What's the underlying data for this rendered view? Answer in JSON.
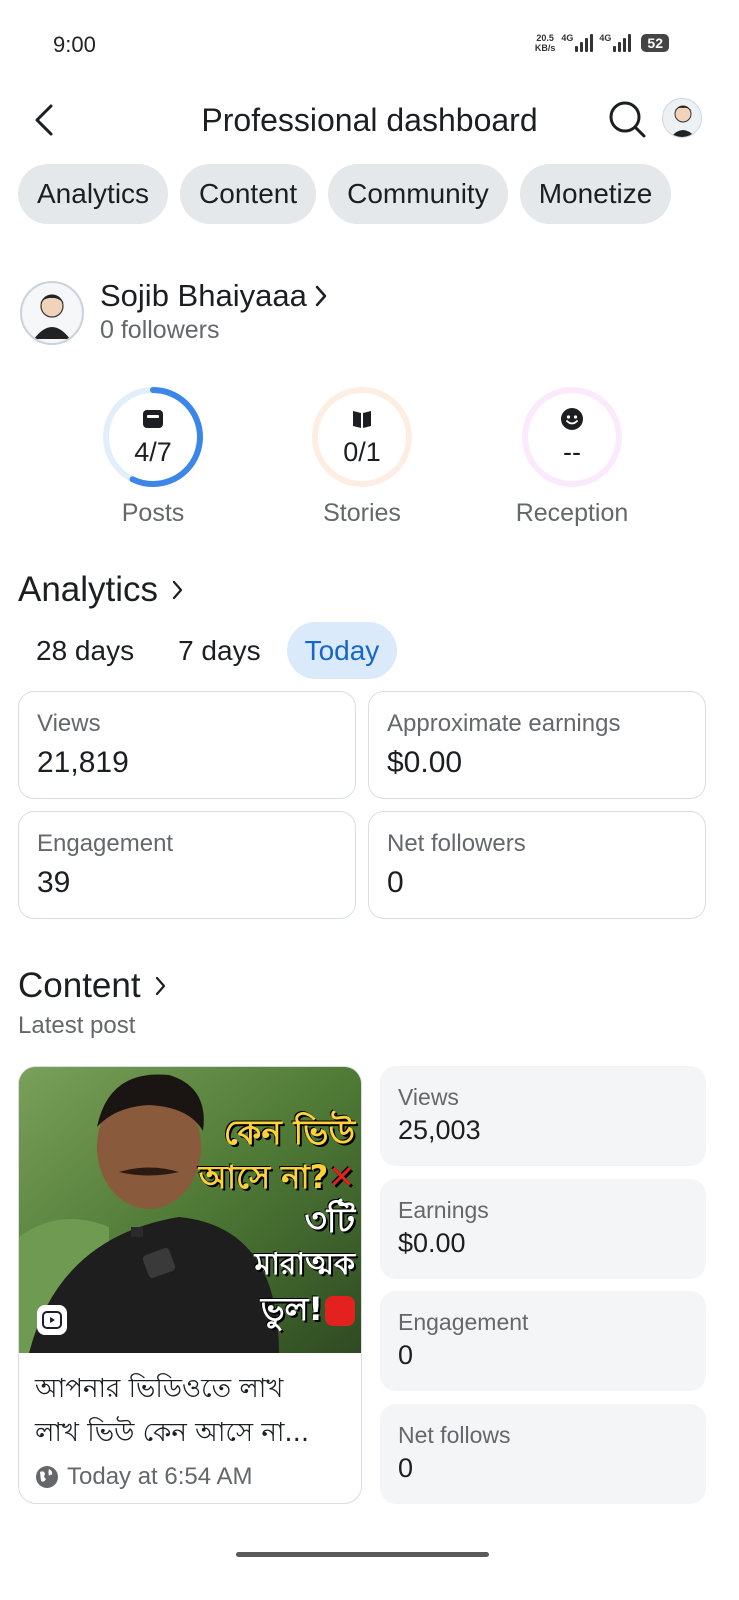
{
  "status_bar": {
    "time": "9:00",
    "net_speed_value": "20.5",
    "net_speed_unit": "KB/s",
    "network_1": "4G",
    "network_2": "4G",
    "battery": "52"
  },
  "header": {
    "title": "Professional dashboard"
  },
  "tabs": [
    {
      "label": "Analytics"
    },
    {
      "label": "Content"
    },
    {
      "label": "Community"
    },
    {
      "label": "Monetize"
    }
  ],
  "profile": {
    "name": "Sojib Bhaiyaaa",
    "followers": "0 followers",
    "avatar_text": "Sojib Bhaiyaaa"
  },
  "goals": [
    {
      "label": "Posts",
      "value": "4/7",
      "icon": "posts-icon",
      "progress": 0.571,
      "color": "#3b86e8",
      "track_color": "#e3eefb"
    },
    {
      "label": "Stories",
      "value": "0/1",
      "icon": "stories-icon",
      "progress": 0,
      "color": "#f1a36b",
      "track_color": "#fdeee4"
    },
    {
      "label": "Reception",
      "value": "--",
      "icon": "reception-icon",
      "progress": 0,
      "color": "#e08ae8",
      "track_color": "#fbe9fc"
    }
  ],
  "analytics": {
    "title": "Analytics",
    "periods": [
      {
        "label": "28 days",
        "active": false
      },
      {
        "label": "7 days",
        "active": false
      },
      {
        "label": "Today",
        "active": true
      }
    ],
    "metrics": [
      {
        "label": "Views",
        "value": "21,819"
      },
      {
        "label": "Approximate earnings",
        "value": "$0.00"
      },
      {
        "label": "Engagement",
        "value": "39"
      },
      {
        "label": "Net followers",
        "value": "0"
      }
    ]
  },
  "content": {
    "title": "Content",
    "subtitle": "Latest post",
    "post": {
      "thumb_text_line1": "কেন ভিউ",
      "thumb_text_line2": "আসে না?",
      "thumb_text_line3": "৩টি",
      "thumb_text_line4": "মারাত্মক",
      "thumb_text_line5": "ভুল!",
      "caption_line1": "আপনার ভিডিওতে লাখ",
      "caption_line2": "লাখ ভিউ কেন আসে না...",
      "time": "Today at 6:54 AM"
    },
    "stats": [
      {
        "label": "Views",
        "value": "25,003"
      },
      {
        "label": "Earnings",
        "value": "$0.00"
      },
      {
        "label": "Engagement",
        "value": "0"
      },
      {
        "label": "Net follows",
        "value": "0"
      }
    ]
  },
  "colors": {
    "accent": "#1466c7",
    "chip_bg": "#e4e8eb",
    "active_chip_bg": "#dbeafb"
  }
}
